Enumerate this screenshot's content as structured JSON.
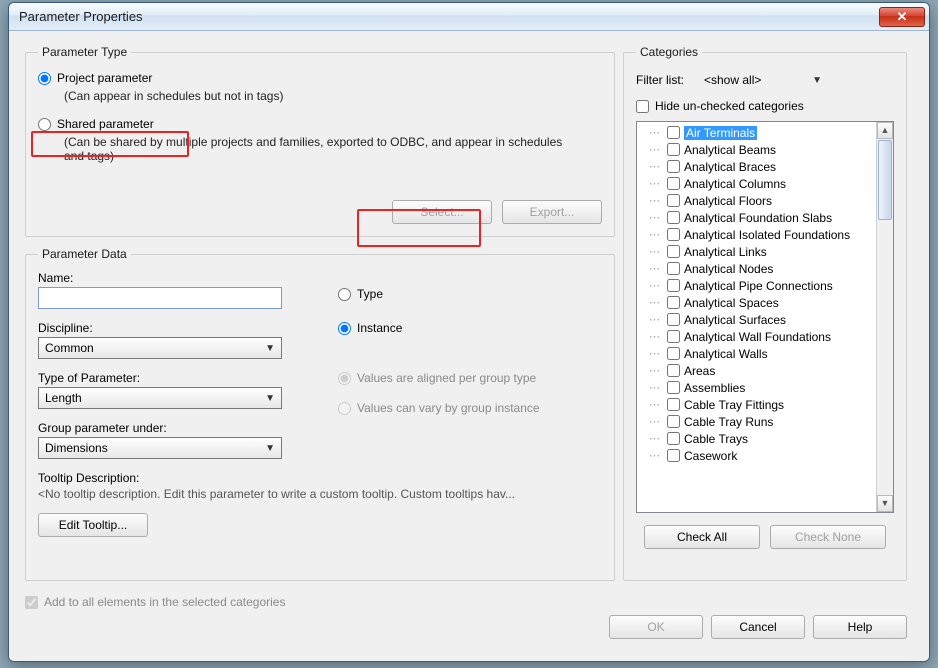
{
  "title": "Parameter Properties",
  "paramType": {
    "legend": "Parameter Type",
    "project": {
      "label": "Project parameter",
      "hint": "(Can appear in schedules but not in tags)"
    },
    "shared": {
      "label": "Shared parameter",
      "hint": "(Can be shared by multiple projects and families, exported to ODBC, and appear in schedules and tags)"
    },
    "selectBtn": "Select...",
    "exportBtn": "Export..."
  },
  "paramData": {
    "legend": "Parameter Data",
    "nameLabel": "Name:",
    "nameValue": "",
    "disciplineLabel": "Discipline:",
    "disciplineValue": "Common",
    "typeOfParamLabel": "Type of Parameter:",
    "typeOfParamValue": "Length",
    "groupUnderLabel": "Group parameter under:",
    "groupUnderValue": "Dimensions",
    "tooltipDescLabel": "Tooltip Description:",
    "tooltipDescValue": "<No tooltip description. Edit this parameter to write a custom tooltip. Custom tooltips hav...",
    "editTooltipBtn": "Edit Tooltip...",
    "typeRadio": "Type",
    "instanceRadio": "Instance",
    "alignedTxt": "Values are aligned per group type",
    "varyTxt": "Values can vary by group instance"
  },
  "categories": {
    "legend": "Categories",
    "filterLabel": "Filter list:",
    "filterValue": "<show all>",
    "hideUnchecked": "Hide un-checked categories",
    "items": [
      "Air Terminals",
      "Analytical Beams",
      "Analytical Braces",
      "Analytical Columns",
      "Analytical Floors",
      "Analytical Foundation Slabs",
      "Analytical Isolated Foundations",
      "Analytical Links",
      "Analytical Nodes",
      "Analytical Pipe Connections",
      "Analytical Spaces",
      "Analytical Surfaces",
      "Analytical Wall Foundations",
      "Analytical Walls",
      "Areas",
      "Assemblies",
      "Cable Tray Fittings",
      "Cable Tray Runs",
      "Cable Trays",
      "Casework"
    ],
    "checkAll": "Check All",
    "checkNone": "Check None"
  },
  "footer": {
    "addToAll": "Add to all elements in the selected categories",
    "ok": "OK",
    "cancel": "Cancel",
    "help": "Help"
  }
}
